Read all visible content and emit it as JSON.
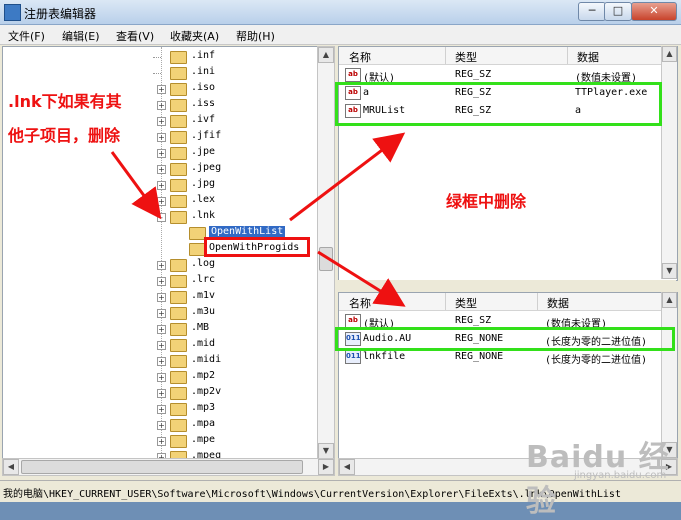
{
  "window": {
    "title": "注册表编辑器",
    "minimize": "─",
    "maximize": "□",
    "close": "✕"
  },
  "menu": [
    "文件(F)",
    "编辑(E)",
    "查看(V)",
    "收藏夹(A)",
    "帮助(H)"
  ],
  "tree": {
    "items": [
      ".inf",
      ".ini",
      ".iso",
      ".iss",
      ".ivf",
      ".jfif",
      ".jpe",
      ".jpeg",
      ".jpg",
      ".lex",
      ".lnk"
    ],
    "children": [
      "OpenWithList",
      "OpenWithProgids"
    ],
    "items_after": [
      ".log",
      ".lrc",
      ".m1v",
      ".m3u",
      ".MB",
      ".mid",
      ".midi",
      ".mp2",
      ".mp2v",
      ".mp3",
      ".mpa",
      ".mpe",
      ".mpeg"
    ],
    "expander_plus": "+",
    "expander_minus": "-"
  },
  "top_pane": {
    "headers": [
      "名称",
      "类型",
      "数据"
    ],
    "rows": [
      {
        "name": "(默认)",
        "type": "REG_SZ",
        "data": "(数值未设置)",
        "icon": "ab"
      },
      {
        "name": "a",
        "type": "REG_SZ",
        "data": "TTPlayer.exe",
        "icon": "ab"
      },
      {
        "name": "MRUList",
        "type": "REG_SZ",
        "data": "a",
        "icon": "ab"
      }
    ]
  },
  "bottom_pane": {
    "headers": [
      "名称",
      "类型",
      "数据"
    ],
    "rows": [
      {
        "name": "(默认)",
        "type": "REG_SZ",
        "data": "(数值未设置)",
        "icon": "ab"
      },
      {
        "name": "Audio.AU",
        "type": "REG_NONE",
        "data": "(长度为零的二进位值)",
        "icon": "011"
      },
      {
        "name": "lnkfile",
        "type": "REG_NONE",
        "data": "(长度为零的二进位值)",
        "icon": "011"
      }
    ]
  },
  "annotations": {
    "left_line1": ".lnk下如果有其",
    "left_line2": "他子项目，删除",
    "right": "绿框中删除"
  },
  "status": "我的电脑\\HKEY_CURRENT_USER\\Software\\Microsoft\\Windows\\CurrentVersion\\Explorer\\FileExts\\.lnk\\OpenWithList",
  "watermark": {
    "main": "Baidu 经验",
    "sub": "jingyan.baidu.com"
  },
  "colors": {
    "highlight_green": "#33e01a",
    "highlight_red": "#ee1111",
    "selection": "#316ac5"
  }
}
